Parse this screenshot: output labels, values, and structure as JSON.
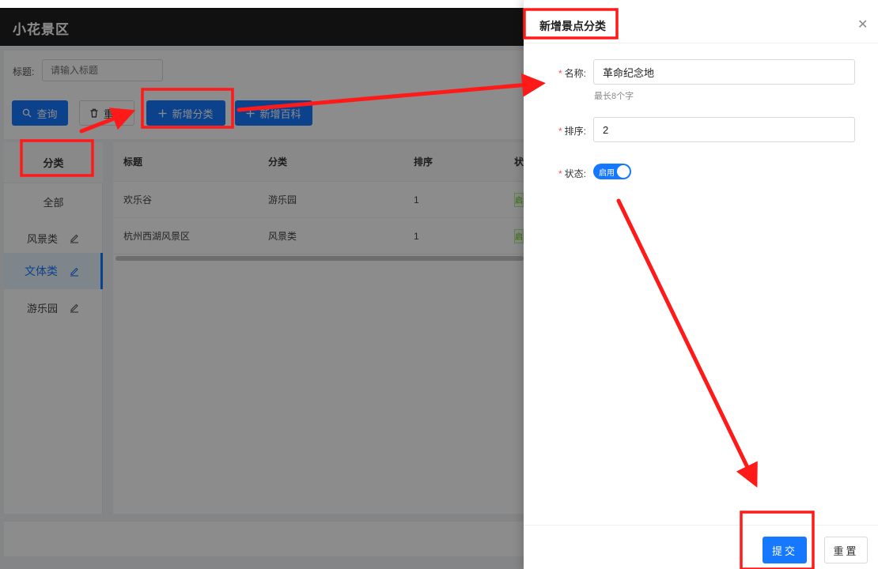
{
  "app": {
    "title": "小花景区"
  },
  "search": {
    "label": "标题:",
    "placeholder": "请输入标题"
  },
  "toolbar": {
    "query_label": "查询",
    "reset_label": "重置",
    "add_category_label": "新增分类",
    "add_wiki_label": "新增百科"
  },
  "sidebar": {
    "header": "分类",
    "items": [
      {
        "label": "全部",
        "editable": false,
        "active": false
      },
      {
        "label": "风景类",
        "editable": true,
        "active": false
      },
      {
        "label": "文体类",
        "editable": true,
        "active": true
      },
      {
        "label": "游乐园",
        "editable": true,
        "active": false
      }
    ]
  },
  "table": {
    "columns": [
      "标题",
      "分类",
      "排序",
      "状"
    ],
    "rows": [
      {
        "title": "欢乐谷",
        "category": "游乐园",
        "order": "1",
        "status": "启"
      },
      {
        "title": "杭州西湖风景区",
        "category": "风景类",
        "order": "1",
        "status": "启"
      }
    ]
  },
  "drawer": {
    "title": "新增景点分类",
    "fields": {
      "name": {
        "label": "名称:",
        "value": "革命纪念地",
        "hint": "最长8个字"
      },
      "order": {
        "label": "排序:",
        "value": "2"
      },
      "status": {
        "label": "状态:",
        "switch_text": "启用",
        "on": true
      }
    },
    "submit_label": "提交",
    "reset_label": "重置"
  },
  "colors": {
    "primary": "#1677ff",
    "header_bg": "#1f1f1f",
    "required": "#ff4d4f",
    "annotation": "#ff1a1a"
  },
  "icons": [
    "search-icon",
    "trash-icon",
    "plus-icon",
    "edit-icon",
    "close-icon"
  ]
}
